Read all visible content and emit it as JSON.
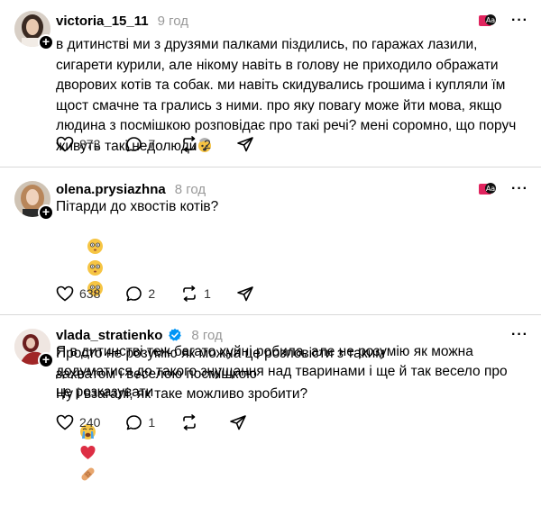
{
  "posts": [
    {
      "username": "victoria_15_11",
      "time": "9 год",
      "verified": false,
      "avatar_icon": "avatar-woman-dark-hair",
      "text": "в дитинстві ми з друзями палками піздились, по гаражах лазили, сигарети курили, але нікому навіть в голову не приходило ображати дворових котів та собак. ми навіть скидувались грошима і купляли їм щост смачне та грались з ними. про яку повагу може йти мова, якщо людина з посмішкою розповідає про такі речі? мені соромно, що поруч живуть такі недолюди",
      "text_emoji": "exploding-head-emoji",
      "likes": "873",
      "replies": "7",
      "reposts": "2",
      "shares": ""
    },
    {
      "username": "olena.prysiazhna",
      "time": "8 год",
      "verified": false,
      "avatar_icon": "avatar-woman-blonde",
      "line1": "Пітарди до хвостів котів?",
      "line1_emoji": "flushed-face-emoji-x3",
      "line2": "Я в дитинстві теж багато хуйні робила, але не розумію як можна додуматися до такого знущання над тваринами і ще й так весело про це розказувати",
      "line3_emoji": "crying-face-heart-bandage-emoji",
      "likes": "638",
      "replies": "2",
      "reposts": "1",
      "shares": ""
    },
    {
      "username": "vlada_stratienko",
      "time": "8 год",
      "verified": true,
      "avatar_icon": "avatar-woman-red",
      "line1": "Просто не розумію як можна це розповісти з таким захватом і веселою посмішкою",
      "line2": "Ну і взагалі, як таке можливо зробити?",
      "likes": "240",
      "replies": "1",
      "reposts": "",
      "shares": ""
    }
  ],
  "colors": {
    "text": "#000000",
    "muted": "#999999",
    "divider": "#d9d9d9",
    "verified": "#0095f6",
    "trans_badge_red": "#e0245e"
  }
}
